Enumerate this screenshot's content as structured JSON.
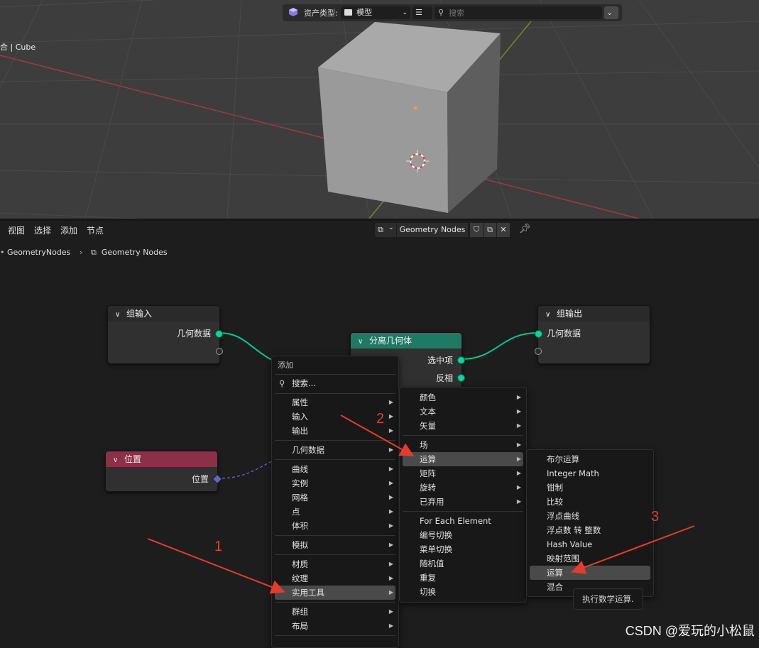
{
  "viewport": {
    "asset_type_label": "资产类型:",
    "asset_type_value": "模型",
    "search_placeholder": "搜索",
    "object_label": "合 | Cube"
  },
  "editor": {
    "menu": [
      "视图",
      "选择",
      "添加",
      "节点"
    ],
    "nodegroup_name": "Geometry Nodes",
    "breadcrumb": [
      "GeometryNodes",
      "Geometry Nodes"
    ]
  },
  "nodes": {
    "group_input": {
      "title": "组输入",
      "output": "几何数据"
    },
    "separate": {
      "title": "分离几何体",
      "out_selection": "选中项",
      "out_inverted": "反相"
    },
    "group_output": {
      "title": "组输出",
      "input": "几何数据"
    },
    "position": {
      "title": "位置",
      "output": "位置"
    }
  },
  "add_menu": {
    "title": "添加",
    "search": "搜索...",
    "items": [
      "属性",
      "输入",
      "输出",
      "几何数据",
      "曲线",
      "实例",
      "网格",
      "点",
      "体积",
      "模拟",
      "材质",
      "纹理",
      "实用工具",
      "群组",
      "布局"
    ],
    "highlighted": "实用工具"
  },
  "utilities_menu": {
    "items": [
      "颜色",
      "文本",
      "矢量",
      "场",
      "运算",
      "矩阵",
      "旋转",
      "已弃用",
      "For Each Element",
      "编号切换",
      "菜单切换",
      "随机值",
      "重复",
      "切换"
    ],
    "highlighted": "运算"
  },
  "math_menu": {
    "items": [
      "布尔运算",
      "Integer Math",
      "钳制",
      "比较",
      "浮点曲线",
      "浮点数 转 整数",
      "Hash Value",
      "映射范围",
      "运算",
      "混合"
    ],
    "highlighted": "运算"
  },
  "tooltip": "执行数学运算.",
  "annotations": [
    "1",
    "2",
    "3"
  ],
  "watermark": "CSDN @爱玩的小松鼠",
  "colors": {
    "socket_geometry": "#00d6a3",
    "header_separate": "#1f7a63",
    "header_position": "#8c3047",
    "annotation": "#e53b2c"
  }
}
